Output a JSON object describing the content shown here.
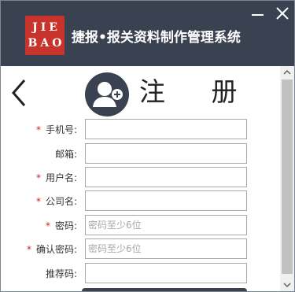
{
  "window": {
    "logo_line1": "JIE",
    "logo_line2": "BAO",
    "app_title": "捷报•报关资料制作管理系统",
    "accent_color": "#3a4251",
    "logo_color": "#c8342c"
  },
  "controls": {
    "minimize_icon": "minimize-icon",
    "close_icon": "close-icon"
  },
  "register": {
    "title": "注 册",
    "back_icon": "chevron-left-icon",
    "avatar_icon": "add-user-icon"
  },
  "form": {
    "fields": [
      {
        "label": "手机号:",
        "required": true,
        "value": "",
        "placeholder": ""
      },
      {
        "label": "邮箱:",
        "required": false,
        "value": "",
        "placeholder": ""
      },
      {
        "label": "用户名:",
        "required": true,
        "value": "",
        "placeholder": ""
      },
      {
        "label": "公司名:",
        "required": true,
        "value": "",
        "placeholder": ""
      },
      {
        "label": "密码:",
        "required": true,
        "value": "",
        "placeholder": "密码至少6位"
      },
      {
        "label": "确认密码:",
        "required": true,
        "value": "",
        "placeholder": "密码至少6位"
      },
      {
        "label": "推荐码:",
        "required": false,
        "value": "",
        "placeholder": ""
      }
    ],
    "required_mark": "*"
  }
}
